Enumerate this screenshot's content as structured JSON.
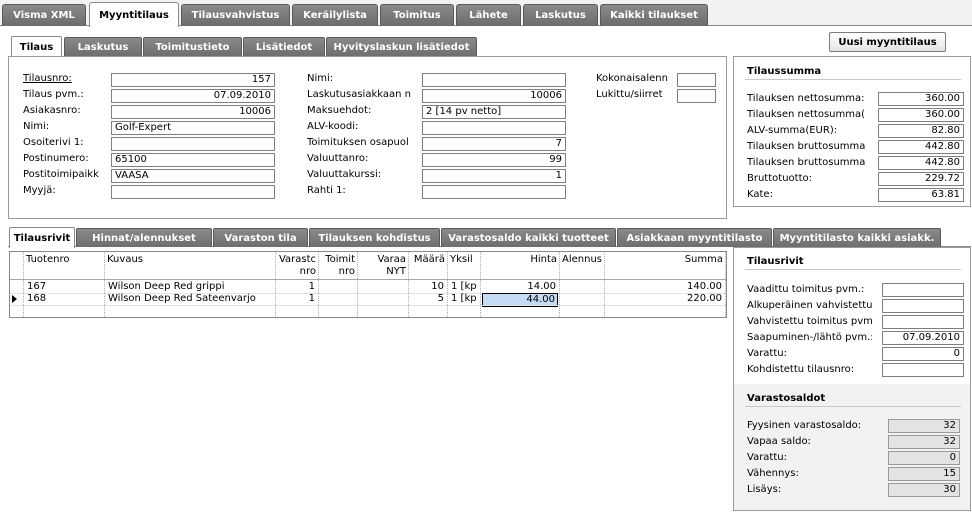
{
  "top_tabs": [
    {
      "label": "Visma XML"
    },
    {
      "label": "Myyntitilaus"
    },
    {
      "label": "Tilausvahvistus"
    },
    {
      "label": "Keräilylista"
    },
    {
      "label": "Toimitus"
    },
    {
      "label": "Lähete"
    },
    {
      "label": "Laskutus"
    },
    {
      "label": "Kaikki tilaukset"
    }
  ],
  "sub_tabs": [
    {
      "label": "Tilaus"
    },
    {
      "label": "Laskutus"
    },
    {
      "label": "Toimitustieto"
    },
    {
      "label": "Lisätiedot"
    },
    {
      "label": "Hyvityslaskun lisätiedot"
    }
  ],
  "new_order_button": "Uusi myyntitilaus",
  "order_fields_col1": [
    {
      "label": "Tilausnro:",
      "value": "157",
      "align": "r"
    },
    {
      "label": "Tilaus pvm.:",
      "value": "07.09.2010",
      "align": "r"
    },
    {
      "label": "Asiakasnro:",
      "value": "10006",
      "align": "r"
    },
    {
      "label": "Nimi:",
      "value": "Golf-Expert",
      "align": "l"
    },
    {
      "label": "Osoiterivi 1:",
      "value": "",
      "align": "l"
    },
    {
      "label": "Postinumero:",
      "value": "65100",
      "align": "l"
    },
    {
      "label": "Postitoimipaikk",
      "value": "VAASA",
      "align": "l"
    },
    {
      "label": "Myyjä:",
      "value": "",
      "align": "l"
    }
  ],
  "order_fields_col2": [
    {
      "label": "Nimi:",
      "value": "",
      "align": "l"
    },
    {
      "label": "Laskutusasiakkaan n",
      "value": "10006",
      "align": "r"
    },
    {
      "label": "Maksuehdot:",
      "value": "2 [14 pv netto]",
      "align": "l"
    },
    {
      "label": "ALV-koodi:",
      "value": "",
      "align": "l"
    },
    {
      "label": "Toimituksen osapuol",
      "value": "7",
      "align": "r"
    },
    {
      "label": "Valuuttanro:",
      "value": "99",
      "align": "r"
    },
    {
      "label": "Valuuttakurssi:",
      "value": "1",
      "align": "r"
    },
    {
      "label": "Rahti 1:",
      "value": "",
      "align": "l"
    }
  ],
  "order_fields_col3": [
    {
      "label": "Kokonaisalenn",
      "value": ""
    },
    {
      "label": "Lukittu/siirret",
      "value": ""
    }
  ],
  "summary": {
    "title": "Tilaussumma",
    "rows": [
      {
        "label": "Tilauksen nettosumma:",
        "value": "360.00"
      },
      {
        "label": "Tilauksen nettosumma(",
        "value": "360.00"
      },
      {
        "label": "ALV-summa(EUR):",
        "value": "82.80"
      },
      {
        "label": "Tilauksen bruttosumma",
        "value": "442.80"
      },
      {
        "label": "Tilauksen bruttosumma",
        "value": "442.80"
      },
      {
        "label": "Bruttotuotto:",
        "value": "229.72"
      },
      {
        "label": "Kate:",
        "value": "63.81"
      }
    ]
  },
  "lower_tabs": [
    {
      "label": "Tilausrivit"
    },
    {
      "label": "Hinnat/alennukset"
    },
    {
      "label": "Varaston tila"
    },
    {
      "label": "Tilauksen kohdistus"
    },
    {
      "label": "Varastosaldo kaikki tuotteet"
    },
    {
      "label": "Asiakkaan myyntitilasto"
    },
    {
      "label": "Myyntitilasto kaikki asiakk."
    }
  ],
  "grid": {
    "headers": [
      {
        "l1": "Tuotenro",
        "l2": ""
      },
      {
        "l1": "Kuvaus",
        "l2": ""
      },
      {
        "l1": "Varastc",
        "l2": "nro"
      },
      {
        "l1": "Toimit",
        "l2": "nro"
      },
      {
        "l1": "Varaa",
        "l2": "NYT"
      },
      {
        "l1": "Määrä",
        "l2": ""
      },
      {
        "l1": "Yksil",
        "l2": ""
      },
      {
        "l1": "Hinta",
        "l2": ""
      },
      {
        "l1": "Alennus",
        "l2": ""
      },
      {
        "l1": "Summa",
        "l2": ""
      }
    ],
    "rows": [
      {
        "cells": [
          "167",
          "Wilson Deep Red grippi",
          "1",
          "",
          "",
          "10",
          "1 [kp",
          "14.00",
          "",
          "140.00"
        ],
        "current": false
      },
      {
        "cells": [
          "168",
          "Wilson Deep Red Sateenvarjo",
          "1",
          "",
          "",
          "5",
          "1 [kp",
          "44.00",
          "",
          "220.00"
        ],
        "current": true
      }
    ]
  },
  "row_details": {
    "title": "Tilausrivit",
    "rows": [
      {
        "label": "Vaadittu toimitus pvm.:",
        "value": ""
      },
      {
        "label": "Alkuperäinen vahvistettu",
        "value": ""
      },
      {
        "label": "Vahvistettu toimitus pvm",
        "value": ""
      },
      {
        "label": "Saapuminen-/lähtö pvm.:",
        "value": "07.09.2010"
      },
      {
        "label": "Varattu:",
        "value": "0"
      },
      {
        "label": "Kohdistettu tilausnro:",
        "value": ""
      }
    ]
  },
  "stock": {
    "title": "Varastosaldot",
    "rows": [
      {
        "label": "Fyysinen varastosaldo:",
        "value": "32"
      },
      {
        "label": "Vapaa saldo:",
        "value": "32"
      },
      {
        "label": "Varattu:",
        "value": "0"
      },
      {
        "label": "Vähennys:",
        "value": "15"
      },
      {
        "label": "Lisäys:",
        "value": "30"
      }
    ]
  },
  "colors": {
    "tab": "#7a7a7a",
    "selected_cell": "#c6dbf5"
  },
  "icons": {
    "row_pointer": "triangle-right"
  }
}
